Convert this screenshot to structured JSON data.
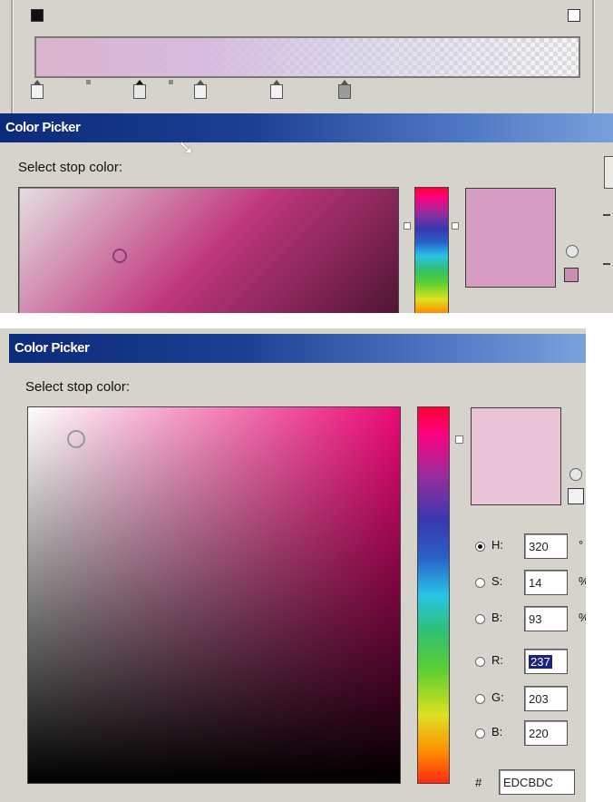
{
  "top": {
    "title": "Color Picker",
    "prompt": "Select stop color:"
  },
  "bottom": {
    "title": "Color Picker",
    "prompt": "Select stop color:",
    "channels": [
      {
        "id": "h",
        "label": "H:",
        "value": "320",
        "unit": "°",
        "selected": true,
        "highlight": false
      },
      {
        "id": "s",
        "label": "S:",
        "value": "14",
        "unit": "%",
        "selected": false,
        "highlight": false
      },
      {
        "id": "b",
        "label": "B:",
        "value": "93",
        "unit": "%",
        "selected": false,
        "highlight": false
      },
      {
        "id": "r",
        "label": "R:",
        "value": "237",
        "unit": "",
        "selected": false,
        "highlight": true
      },
      {
        "id": "g",
        "label": "G:",
        "value": "203",
        "unit": "",
        "selected": false,
        "highlight": false
      },
      {
        "id": "bl",
        "label": "B:",
        "value": "220",
        "unit": "",
        "selected": false,
        "highlight": false
      }
    ],
    "hex_label": "#",
    "hex_value": "EDCBDC"
  },
  "colors": {
    "current_top": "#d69bc0",
    "current_bottom": "#e8c4d6",
    "titlebar": "#1d3f92"
  }
}
